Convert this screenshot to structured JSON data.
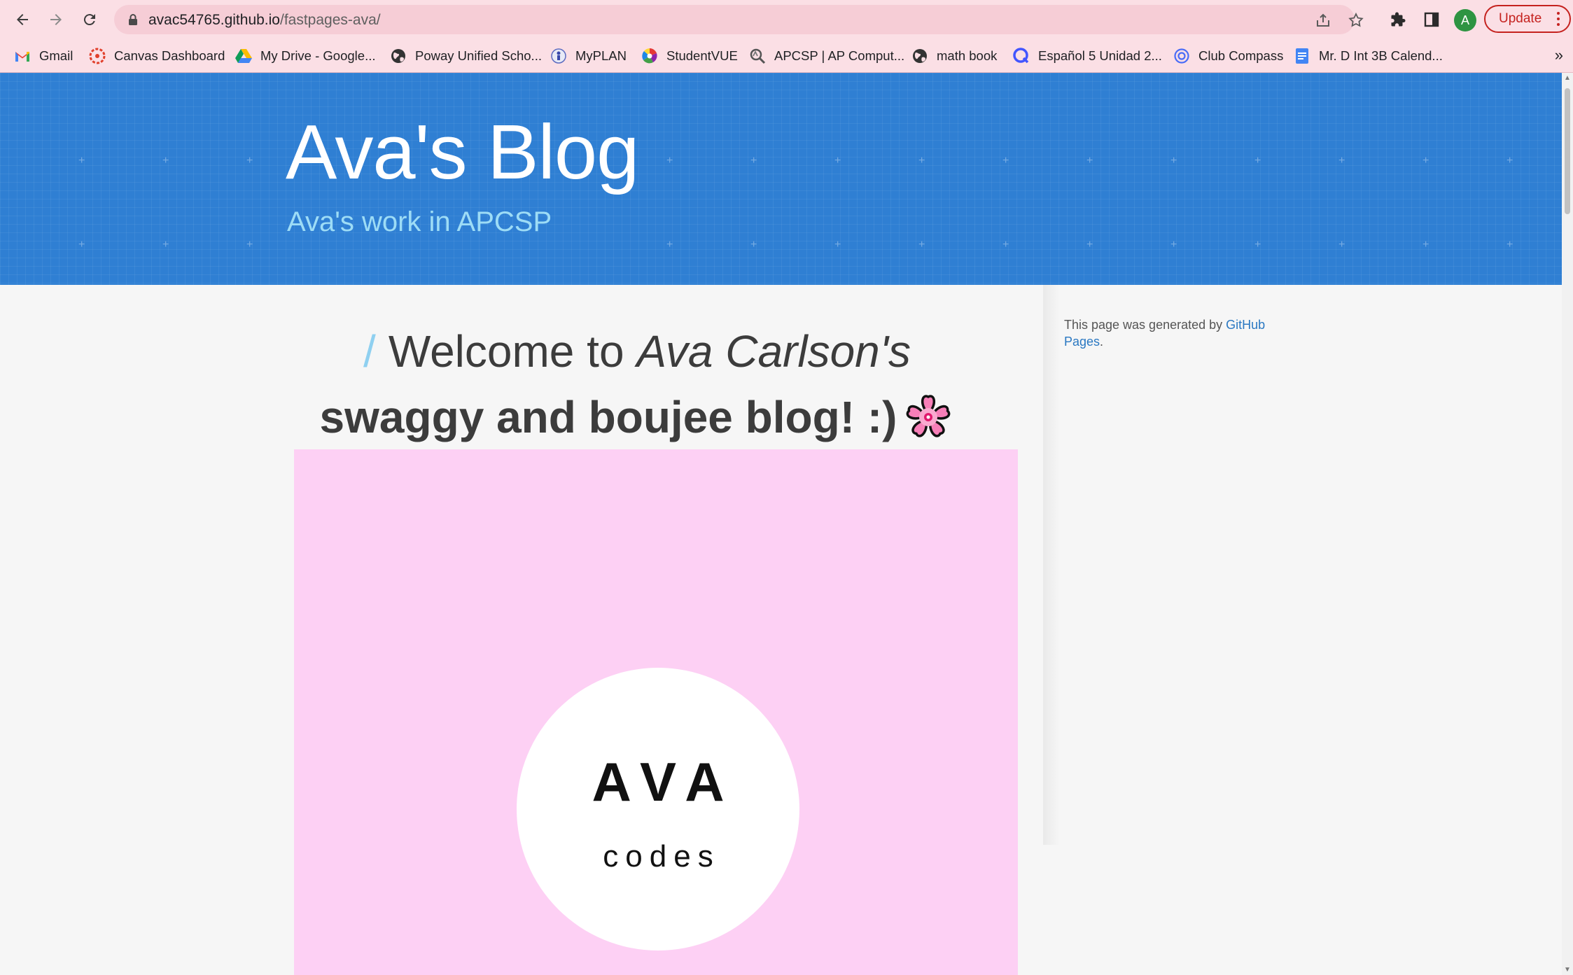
{
  "browser": {
    "url_host": "avac54765.github.io",
    "url_path": "/fastpages-ava/",
    "profile_initial": "A",
    "update_label": "Update",
    "bookmarks": [
      {
        "label": "Gmail",
        "icon": "gmail-icon"
      },
      {
        "label": "Canvas Dashboard",
        "icon": "canvas-icon"
      },
      {
        "label": "My Drive - Google...",
        "icon": "google-drive-icon"
      },
      {
        "label": "Poway Unified Scho...",
        "icon": "globe-icon"
      },
      {
        "label": "MyPLAN",
        "icon": "myplan-icon"
      },
      {
        "label": "StudentVUE",
        "icon": "studentvue-icon"
      },
      {
        "label": "APCSP | AP Comput...",
        "icon": "apcsp-icon"
      },
      {
        "label": "math book",
        "icon": "globe-icon"
      },
      {
        "label": "Español 5 Unidad 2...",
        "icon": "quizlet-icon"
      },
      {
        "label": "Club Compass",
        "icon": "club-compass-icon"
      },
      {
        "label": "Mr. D Int 3B Calend...",
        "icon": "google-docs-icon"
      }
    ],
    "bookmarks_more": "»"
  },
  "site": {
    "title": "Ava's Blog",
    "description": "Ava's work in APCSP"
  },
  "post": {
    "slash": "/",
    "heading_part1": "Welcome to ",
    "heading_italic": "Ava Carlson's",
    "heading_bold": "swaggy and boujee blog! :)",
    "hero_logo_main": "AVA",
    "hero_logo_sub": "codes",
    "hero_bg": "#fdd0f4"
  },
  "sidebar": {
    "text": "This page was generated by ",
    "link": "GitHub Pages",
    "suffix": "."
  },
  "colors": {
    "header_bg": "#2f7fd3",
    "title": "#ffffff",
    "subtitle": "#9ddcf6",
    "chrome": "#fbdfe5"
  }
}
